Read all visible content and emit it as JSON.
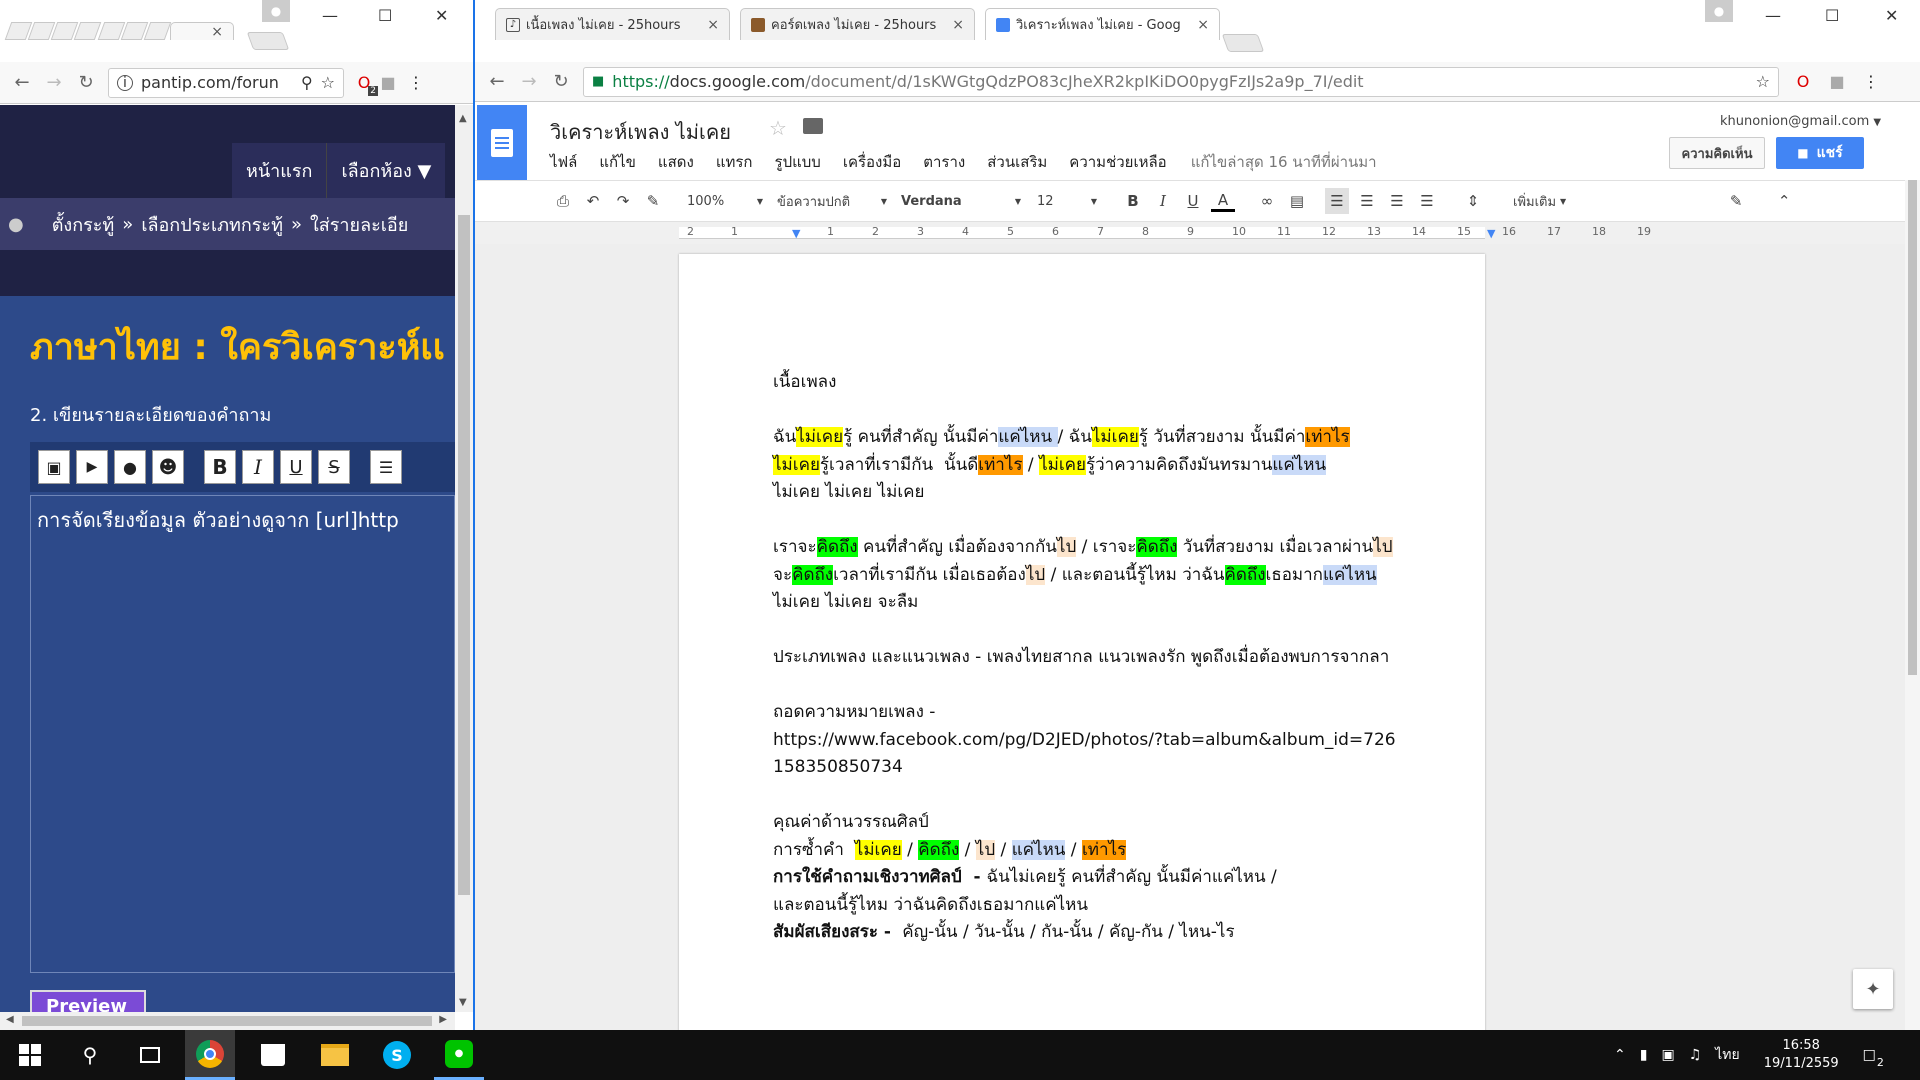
{
  "left": {
    "tabs": [
      {
        "label": "",
        "close": "×"
      }
    ],
    "url": "pantip.com/forun",
    "ext_badge": "2",
    "nav": [
      "หน้าแรก",
      "เลือกห้อง ▼"
    ],
    "breadcrumb": [
      "ตั้งกระทู้",
      "»",
      "เลือกประเภทกระทู้",
      "»",
      "ใส่รายละเอีย"
    ],
    "title": "ภาษาไทย : ใครวิเคราะห์เเ",
    "section": "2. เขียนรายละเอียดของคำถาม",
    "editor_buttons": [
      "B",
      "I",
      "U",
      "S"
    ],
    "editor_text": "การจัดเรียงข้อมูล ตัวอย่างดูจาก [url]http",
    "preview": "Preview"
  },
  "right": {
    "tabs": [
      {
        "label": "เนื้อเพลง ไม่เคย - 25hours",
        "close": "×",
        "color": "#555"
      },
      {
        "label": "คอร์ดเพลง ไม่เคย - 25hours",
        "close": "×",
        "color": "#8b5a2b"
      },
      {
        "label": "วิเคราะห์เพลง ไม่เคย - Goog",
        "close": "×",
        "color": "#4285f4"
      }
    ],
    "url_scheme": "https://",
    "url_host": "docs.google.com",
    "url_path": "/document/d/1sKWGtgQdzPO83cJheXR2kpIKiDO0pygFzIJs2a9p_7I/edit"
  },
  "doc": {
    "title": "วิเคราะห์เพลง ไม่เคย",
    "menu": [
      "ไฟล์",
      "แก้ไข",
      "แสดง",
      "แทรก",
      "รูปแบบ",
      "เครื่องมือ",
      "ตาราง",
      "ส่วนเสริม",
      "ความช่วยเหลือ"
    ],
    "last_edit": "แก้ไขล่าสุด 16 นาทีที่ผ่านมา",
    "account": "khunonion@gmail.com",
    "comments_btn": "ความคิดเห็น",
    "share_btn": "แชร์",
    "zoom": "100%",
    "style": "ข้อความปกติ",
    "font": "Verdana",
    "size": "12",
    "more": "เพิ่มเติม",
    "ruler": [
      "2",
      "1",
      "1",
      "2",
      "3",
      "4",
      "5",
      "6",
      "7",
      "8",
      "9",
      "10",
      "11",
      "12",
      "13",
      "14",
      "15",
      "16",
      "17",
      "18",
      "19"
    ],
    "lines": [
      [
        {
          "t": "เนื้อเพลง"
        }
      ],
      [],
      [
        {
          "t": "ฉัน"
        },
        {
          "t": "ไม่เคย",
          "h": "y"
        },
        {
          "t": "รู้ คนที่สำคัญ นั้นมีค่า"
        },
        {
          "t": "แค่ไหน ",
          "h": "b"
        },
        {
          "t": "/ ฉัน"
        },
        {
          "t": "ไม่เคย",
          "h": "y"
        },
        {
          "t": "รู้ วันที่สวยงาม นั้นมีค่า"
        },
        {
          "t": "เท่าไร",
          "h": "o"
        }
      ],
      [
        {
          "t": "ไม่เคย",
          "h": "y"
        },
        {
          "t": "รู้เวลาที่เรามีกัน  นั้นดี"
        },
        {
          "t": "เท่าไร",
          "h": "o"
        },
        {
          "t": " / "
        },
        {
          "t": "ไม่เคย",
          "h": "y"
        },
        {
          "t": "รู้ว่าความคิดถึงมันทรมาน"
        },
        {
          "t": "แค่ไหน",
          "h": "b"
        }
      ],
      [
        {
          "t": "ไม่เคย ไม่เคย ไม่เคย"
        }
      ],
      [],
      [
        {
          "t": "เราจะ"
        },
        {
          "t": "คิดถึง",
          "h": "g"
        },
        {
          "t": " คนที่สำคัญ เมื่อต้องจากกัน"
        },
        {
          "t": "ไป",
          "h": "p"
        },
        {
          "t": " / เราจะ"
        },
        {
          "t": "คิดถึง",
          "h": "g"
        },
        {
          "t": " วันที่สวยงาม เมื่อเวลาผ่าน"
        },
        {
          "t": "ไป",
          "h": "p"
        }
      ],
      [
        {
          "t": "จะ"
        },
        {
          "t": "คิดถึง",
          "h": "g"
        },
        {
          "t": "เวลาที่เรามีกัน เมื่อเธอต้อง"
        },
        {
          "t": "ไป",
          "h": "p"
        },
        {
          "t": " / และตอนนี้รู้ไหม ว่าฉัน"
        },
        {
          "t": "คิดถึง",
          "h": "g"
        },
        {
          "t": "เธอมาก"
        },
        {
          "t": "แค่ไหน",
          "h": "b"
        }
      ],
      [
        {
          "t": "ไม่เคย ไม่เคย จะลืม"
        }
      ],
      [],
      [
        {
          "t": "ประเภทเพลง และแนวเพลง - เพลงไทยสากล แนวเพลงรัก พูดถึงเมื่อต้องพบการจากลา"
        }
      ],
      [],
      [
        {
          "t": "ถอดความหมายเพลง -"
        }
      ],
      [
        {
          "t": "https://www.facebook.com/pg/D2JED/photos/?tab=album&album_id=726"
        }
      ],
      [
        {
          "t": "158350850734"
        }
      ],
      [],
      [
        {
          "t": "คุณค่าด้านวรรณศิลป์"
        }
      ],
      [
        {
          "t": "การซ้ำคำ  "
        },
        {
          "t": "ไม่เคย",
          "h": "y"
        },
        {
          "t": " / "
        },
        {
          "t": "คิดถึง",
          "h": "g"
        },
        {
          "t": " / "
        },
        {
          "t": "ไป",
          "h": "p"
        },
        {
          "t": " / "
        },
        {
          "t": "แค่ไหน",
          "h": "b"
        },
        {
          "t": " / "
        },
        {
          "t": "เท่าไร",
          "h": "o"
        }
      ],
      [
        {
          "t": "การใช้คำถามเชิงวาทศิลป์  - ",
          "b": true
        },
        {
          "t": "ฉันไม่เคยรู้ คนที่สำคัญ นั้นมีค่าแค่ไหน /"
        }
      ],
      [
        {
          "t": "และตอนนี้รู้ไหม ว่าฉันคิดถึงเธอมากแค่ไหน"
        }
      ],
      [
        {
          "t": "สัมผัสเสียงสระ - ",
          "b": true
        },
        {
          "t": " คัญ-นั้น / วัน-นั้น / กัน-นั้น / คัญ-กัน / ไหน-ไร"
        }
      ]
    ]
  },
  "taskbar": {
    "lang": "ไทย",
    "time": "16:58",
    "date": "19/11/2559",
    "notif": "2"
  },
  "colors": {
    "gdocs_blue": "#4285f4",
    "pantip_dark": "#1f2244",
    "pantip_blue": "#2d4a8a",
    "pantip_gold": "#ffc107"
  }
}
